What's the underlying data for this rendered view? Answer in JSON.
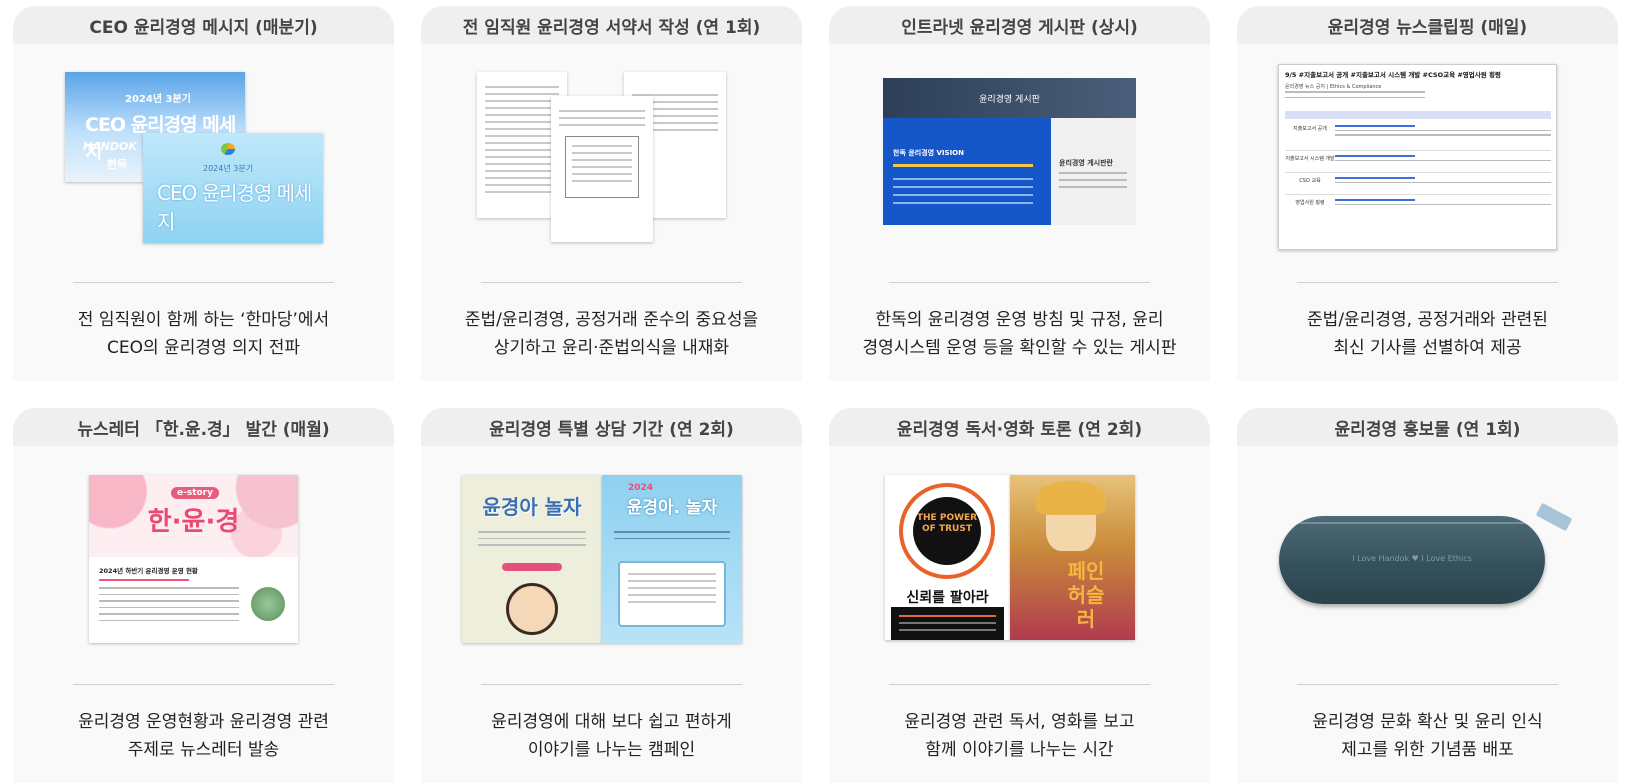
{
  "cards": [
    {
      "title": "CEO 윤리경영 메시지 (매분기)",
      "desc": [
        "전 임직원이 함께 하는 ‘한마당’에서",
        "CEO의 윤리경영 의지 전파"
      ],
      "image": {
        "back_caption": "2024년 3분기",
        "back_title": "CEO 윤리경영 메세지",
        "back_logo": "HANDOK",
        "back_sign": "한독",
        "front_caption": "2024년 3분기",
        "front_title": "CEO 윤리경영 메세지"
      }
    },
    {
      "title": "전 임직원 윤리경영 서약서 작성 (연 1회)",
      "desc": [
        "준법/윤리경영, 공정거래 준수의 중요성을",
        "상기하고 윤리·준법의식을 내재화"
      ]
    },
    {
      "title": "인트라넷 윤리경영 게시판 (상시)",
      "desc": [
        "한독의 윤리경영 운영 방침 및 규정, 윤리",
        "경영시스템 운영 등을 확인할 수 있는 게시판"
      ],
      "image": {
        "board_title": "윤리경영 게시판",
        "vision_title": "한독 윤리경영 VISION",
        "side_title": "윤리경영 게시판란"
      }
    },
    {
      "title": "윤리경영 뉴스클립핑 (매일)",
      "desc": [
        "준법/윤리경영, 공정거래와 관련된",
        "최신 기사를 선별하여 제공"
      ],
      "image": {
        "headline": "9/5 #지출보고서 공개 #지출보고서 시스템 개발 #CSO교육 #영업사원 횡령",
        "sub": "윤리경영 뉴스 공지 | Ethics & Compliance",
        "rows": [
          "지출보고서 공개",
          "지출보고서 시스템 개발",
          "CSO 교육",
          "영업사원 횡령"
        ]
      }
    },
    {
      "title": "뉴스레터 「한.윤.경」 발간 (매월)",
      "desc": [
        "윤리경영 운영현황과 윤리경영 관련",
        "주제로 뉴스레터 발송"
      ],
      "image": {
        "badge": "e-story",
        "title": "한·윤·경",
        "section": "2024년 하반기 윤리경영 운영 현황"
      }
    },
    {
      "title": "윤리경영 특별 상담 기간 (연 2회)",
      "desc": [
        "윤리경영에 대해 보다 쉽고 편하게",
        "이야기를 나누는 캠페인"
      ],
      "image": {
        "left_title": "윤경아 놀자",
        "right_year": "2024",
        "right_title": "윤경아. 놀자"
      }
    },
    {
      "title": "윤리경영 독서·영화 토론 (연 2회)",
      "desc": [
        "윤리경영 관련 독서, 영화를 보고",
        "함께 이야기를 나누는 시간"
      ],
      "image": {
        "book_title": "THE POWER OF TRUST",
        "book_kr": "신뢰를 팔아라",
        "movie_title": "페인 허슬러"
      }
    },
    {
      "title": "윤리경영 홍보물 (연 1회)",
      "desc": [
        "윤리경영 문화 확산 및 윤리 인식",
        "제고를 위한 기념품 배포"
      ],
      "image": {
        "engraving": "I Love Handok ♥ I Love Ethics"
      }
    }
  ],
  "colors": {
    "header_bg": "#efefef",
    "card_bg": "#f9f9f9",
    "divider": "#cfcfcf",
    "accent_sky": "#9fd8f0",
    "intranet_blue": "#1556c8",
    "pink": "#f7c2cf",
    "case_teal": "#3a5560"
  }
}
